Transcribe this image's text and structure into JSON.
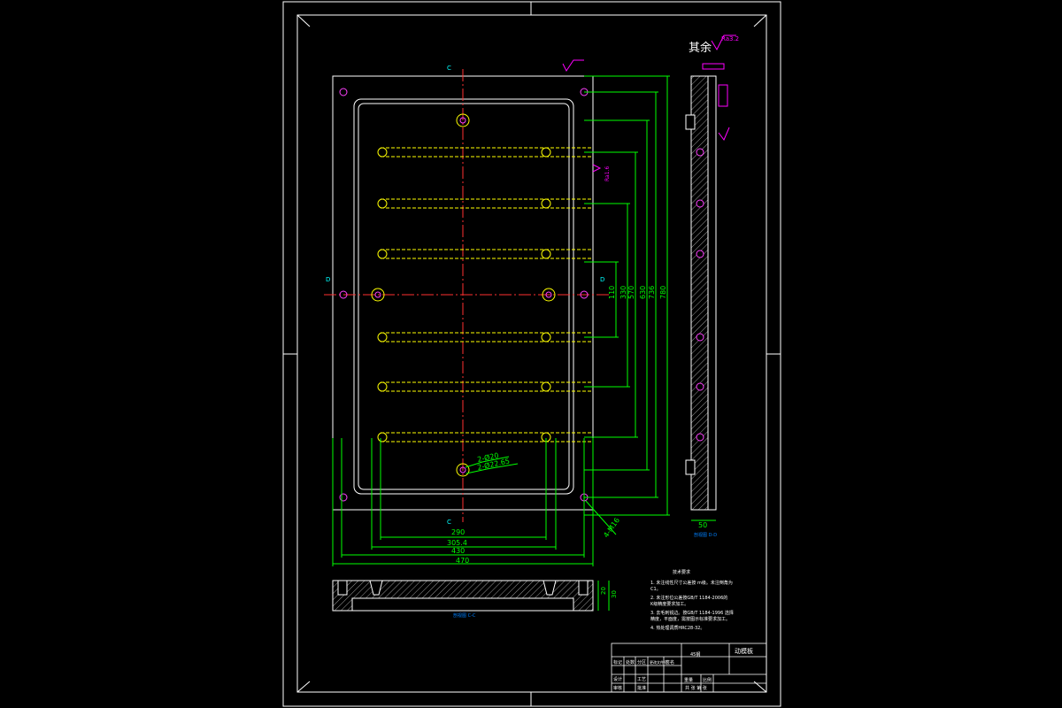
{
  "colors": {
    "background": "#000000",
    "frame": "#ffffff",
    "dimension": "#00ff00",
    "centerline": "#ff3030",
    "hidden": "#ffff00",
    "hole": "#ff40ff",
    "surface_mark": "#ff00ff",
    "text": "#00ffff"
  },
  "drawing": {
    "dims_horizontal": [
      {
        "id": "dim-290",
        "text": "290"
      },
      {
        "id": "dim-3054",
        "text": "305.4"
      },
      {
        "id": "dim-430",
        "text": "430"
      },
      {
        "id": "dim-470",
        "text": "470"
      }
    ],
    "dims_vertical": [
      {
        "id": "dim-110",
        "text": "110"
      },
      {
        "id": "dim-330",
        "text": "330"
      },
      {
        "id": "dim-570",
        "text": "570"
      },
      {
        "id": "dim-630",
        "text": "630"
      },
      {
        "id": "dim-736",
        "text": "736"
      },
      {
        "id": "dim-780",
        "text": "780"
      }
    ],
    "hole_notes": [
      "2-Ø20",
      "2-Ø22.65"
    ],
    "corner_note": "4-M16",
    "section_marks": {
      "c": "C",
      "d": "D"
    },
    "roughness_top": "Ra3.2",
    "roughness_mark": "Ra1.6",
    "side_label": "其余",
    "side_dim": "50",
    "bottom_dims": [
      "20",
      "30"
    ],
    "section_caption_right": "剖视图 D-D",
    "section_caption_bottom": "剖视图 C-C"
  },
  "notes": {
    "title": "技术要求",
    "lines": [
      "1. 未注线性尺寸公差按 m级。未注倒角为",
      "   C1。",
      "2. 未注形位公差按GB/T 1184-2006的",
      "   K级精度要求加工。",
      "3. 去毛刺锐边。按GB/T 1184-1996 选择",
      "   精度，平面度，需按图示标准要求加工。",
      "4. 热处理调质HRC28-32。"
    ]
  },
  "title_block": {
    "part_name": "动模板",
    "material": "45钢",
    "weight": "重量",
    "scale": "比例",
    "sheet": "共 张 第 张",
    "labels": [
      "标记",
      "处数",
      "分区",
      "更改文件号",
      "签名",
      "年月日",
      "设计",
      "审核",
      "工艺",
      "批准"
    ]
  }
}
